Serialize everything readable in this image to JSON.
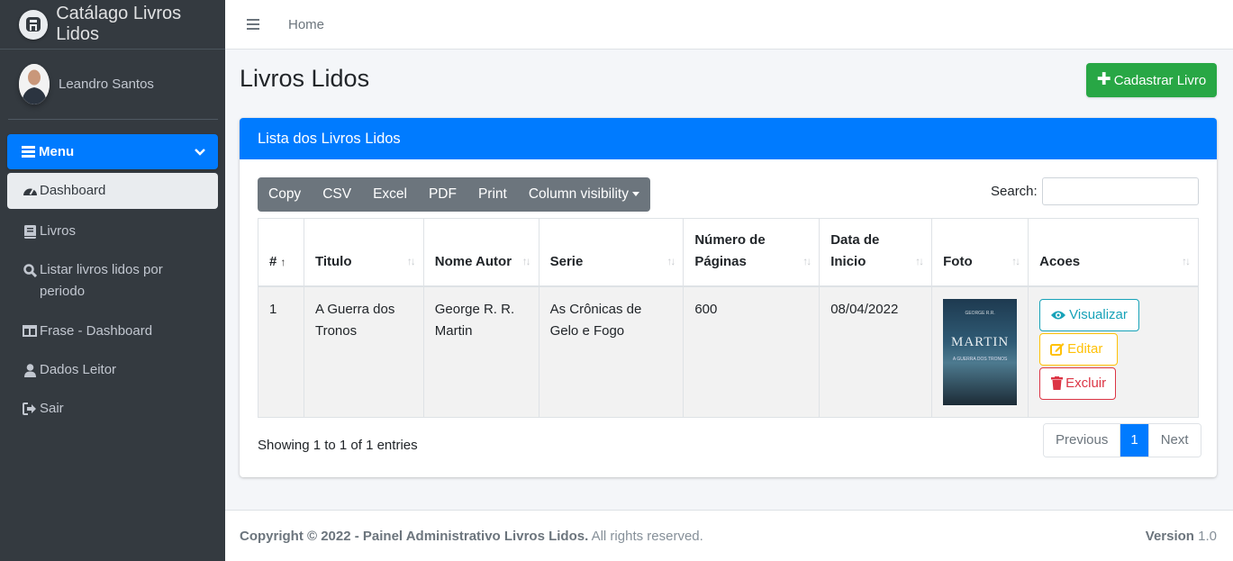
{
  "brand": {
    "title": "Catálago Livros Lidos"
  },
  "user": {
    "name": "Leandro Santos"
  },
  "sidebar": {
    "menu_label": "Menu",
    "items": [
      {
        "label": "Dashboard",
        "icon": "tachometer-icon",
        "active": true
      },
      {
        "label": "Livros",
        "icon": "book-icon"
      },
      {
        "label": "Listar livros lidos por periodo",
        "icon": "search-icon"
      },
      {
        "label": "Frase - Dashboard",
        "icon": "columns-icon"
      },
      {
        "label": "Dados Leitor",
        "icon": "user-icon"
      },
      {
        "label": "Sair",
        "icon": "sign-out-icon"
      }
    ]
  },
  "navbar": {
    "home": "Home"
  },
  "page": {
    "title": "Livros Lidos",
    "add_button": "Cadastrar Livro"
  },
  "card": {
    "header": "Lista dos Livros Lidos",
    "export_buttons": [
      "Copy",
      "CSV",
      "Excel",
      "PDF",
      "Print",
      "Column visibility"
    ],
    "search_label": "Search:",
    "search_value": "",
    "columns": [
      "#",
      "Titulo",
      "Nome Autor",
      "Serie",
      "Número de Páginas",
      "Data de Inicio",
      "Foto",
      "Acoes"
    ],
    "rows": [
      {
        "num": "1",
        "titulo": "A Guerra dos Tronos",
        "autor": "George R. R. Martin",
        "serie": "As Crônicas de Gelo e Fogo",
        "paginas": "600",
        "data": "08/04/2022",
        "cover_author": "MARTIN"
      }
    ],
    "actions": {
      "view": "Visualizar",
      "edit": "Editar",
      "delete": "Excluir"
    },
    "info": "Showing 1 to 1 of 1 entries",
    "pager": {
      "prev": "Previous",
      "current": "1",
      "next": "Next"
    }
  },
  "footer": {
    "copyright": "Copyright © 2022 - Painel Administrativo Livros Lidos.",
    "rights": " All rights reserved.",
    "version_label": "Version",
    "version": "1.0"
  },
  "colors": {
    "primary": "#007bff",
    "success": "#28a745",
    "info": "#17a2b8",
    "warning": "#ffc107",
    "danger": "#dc3545",
    "sidebar": "#343a40"
  }
}
